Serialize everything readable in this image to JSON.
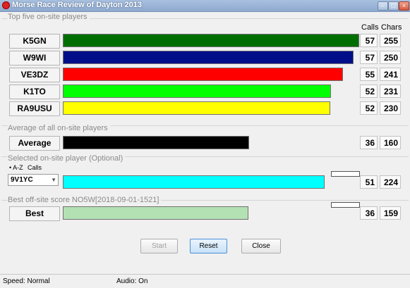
{
  "window": {
    "title": "Morse Race Review of Dayton 2013"
  },
  "colors": {
    "k5gn": "#006e00",
    "w9wi": "#000e8a",
    "ve3dz": "#ff0000",
    "k1to": "#00ff00",
    "ra9usu": "#ffff00",
    "average": "#000000",
    "selected": "#00ffff",
    "best": "#b4e1b4"
  },
  "top_five": {
    "label": "Top five on-site players",
    "calls_header": "Calls",
    "chars_header": "Chars",
    "players": [
      {
        "name": "K5GN",
        "calls": "57",
        "chars": "255"
      },
      {
        "name": "W9WI",
        "calls": "57",
        "chars": "250"
      },
      {
        "name": "VE3DZ",
        "calls": "55",
        "chars": "241"
      },
      {
        "name": "K1TO",
        "calls": "52",
        "chars": "231"
      },
      {
        "name": "RA9USU",
        "calls": "52",
        "chars": "230"
      }
    ]
  },
  "average": {
    "label": "Average of all on-site players",
    "name": "Average",
    "calls": "36",
    "chars": "160"
  },
  "selected": {
    "label": "Selected on-site player (Optional)",
    "sort_az": "A-Z",
    "sort_calls": "Calls",
    "combo_value": "9V1YC",
    "calls": "51",
    "chars": "224"
  },
  "best": {
    "label": "Best off-site score NO5W[2018-09-01-1521]",
    "name": "Best",
    "calls": "36",
    "chars": "159"
  },
  "buttons": {
    "start": "Start",
    "reset": "Reset",
    "close": "Close"
  },
  "status": {
    "speed": "Speed: Normal",
    "audio": "Audio: On"
  }
}
